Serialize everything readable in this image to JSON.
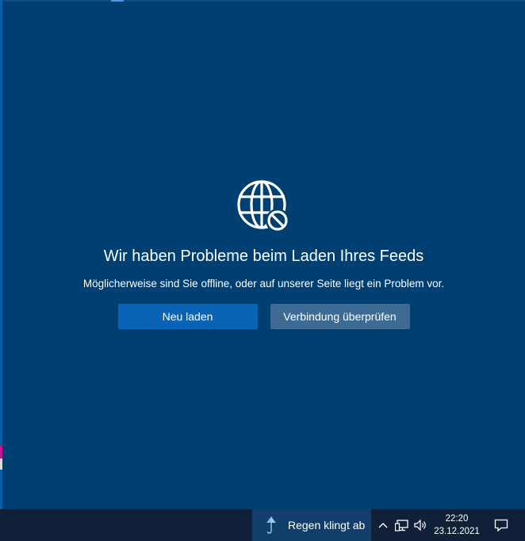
{
  "feed_error": {
    "icon": "globe-blocked-icon",
    "title": "Wir haben Probleme beim Laden Ihres Feeds",
    "message": "Möglicherweise sind Sie offline, oder auf unserer Seite liegt ein Problem vor.",
    "reload_label": "Neu laden",
    "check_connection_label": "Verbindung überprüfen"
  },
  "taskbar": {
    "weather": {
      "icon": "umbrella-rain-icon",
      "text": "Regen klingt ab"
    },
    "tray_icons": [
      "chevron-up-icon",
      "network-icon",
      "speaker-icon"
    ],
    "clock": {
      "time": "22:20",
      "date": "23.12.2021"
    },
    "notification_icon": "action-center-icon"
  },
  "colors": {
    "panel_background": "#003f72",
    "primary_button": "#0a63b5",
    "secondary_button": "#3e6b94",
    "taskbar": "#0f2038",
    "weather_widget": "#113e6b"
  }
}
